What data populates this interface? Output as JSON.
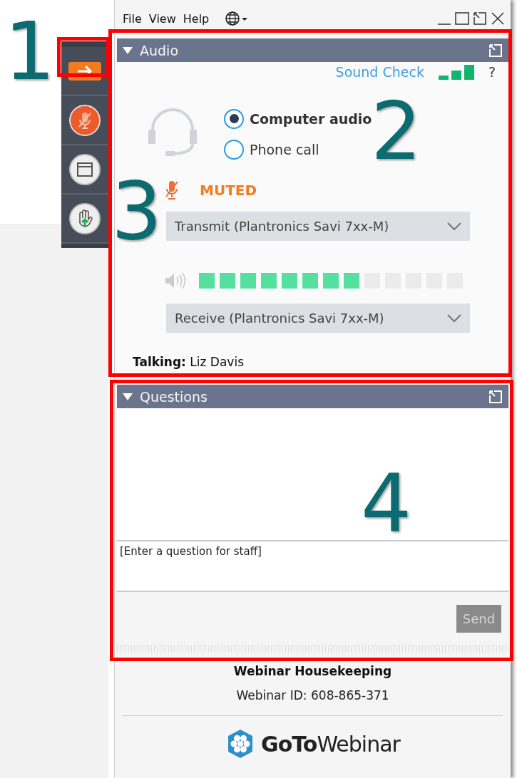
{
  "annotations": [
    {
      "label": "1"
    },
    {
      "label": "2"
    },
    {
      "label": "3"
    },
    {
      "label": "4"
    }
  ],
  "menu": [
    "File",
    "View",
    "Help"
  ],
  "toolbar": [
    {
      "kind": "arrow"
    },
    {
      "kind": "mic"
    },
    {
      "kind": "window"
    },
    {
      "kind": "hand"
    }
  ],
  "audio": {
    "title": "Audio",
    "expanded": true,
    "sound_check": "Sound Check",
    "help": "?",
    "options": [
      {
        "label": "Computer audio",
        "selected": true
      },
      {
        "label": "Phone call",
        "selected": false
      }
    ],
    "mute_status": "MUTED",
    "transmit": "Transmit (Plantronics Savi 7xx-M)",
    "level": 0.615,
    "receive": "Receive (Plantronics Savi 7xx-M)",
    "talking_label": "Talking:",
    "talking_name": "Liz Davis"
  },
  "questions": {
    "title": "Questions",
    "expanded": true,
    "placeholder": "[Enter a question for staff]",
    "send": {
      "label": "Send",
      "disabled": true
    }
  },
  "footer": {
    "title": "Webinar Housekeeping",
    "webinar_id": "Webinar ID: 608-865-371",
    "logo_bold": "GoTo",
    "logo_light": "Webinar"
  }
}
